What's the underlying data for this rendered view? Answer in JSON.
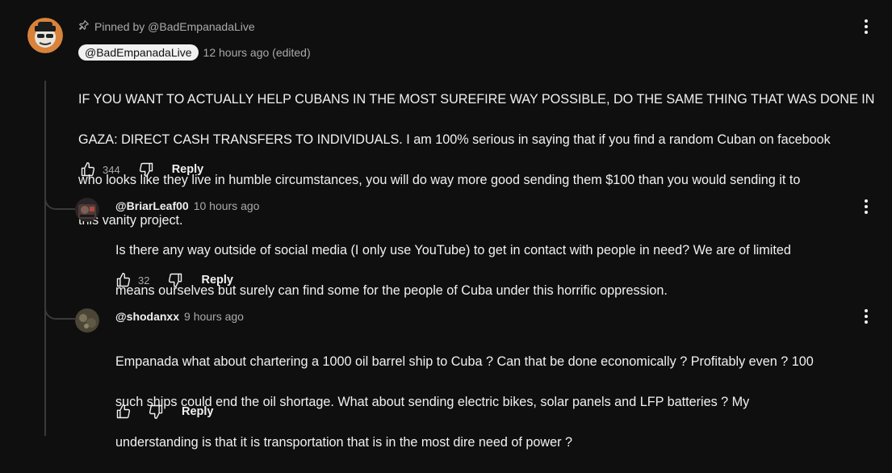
{
  "pinned": {
    "label": "Pinned by @BadEmpanadaLive"
  },
  "comments": [
    {
      "author": "@BadEmpanadaLive",
      "time": "12 hours ago (edited)",
      "lines": [
        "IF YOU WANT TO ACTUALLY HELP CUBANS IN THE MOST SUREFIRE WAY POSSIBLE, DO THE SAME THING THAT WAS DONE IN",
        "GAZA: DIRECT CASH TRANSFERS TO INDIVIDUALS. I am 100% serious in saying that if you find a random Cuban on facebook",
        "who looks like they live in humble circumstances, you will do way more good sending them $100 than you would sending it to",
        "this vanity project."
      ],
      "likes": "344",
      "reply": "Reply"
    },
    {
      "author": "@BriarLeaf00",
      "time": "10 hours ago",
      "lines": [
        "Is there any way outside of social media (I only use YouTube) to get in contact with people in need? We are of limited",
        "means ourselves but surely can find some for the people of Cuba under this horrific oppression."
      ],
      "likes": "32",
      "reply": "Reply"
    },
    {
      "author": "@shodanxx",
      "time": "9 hours ago",
      "lines": [
        "Empanada what about chartering a 1000 oil barrel ship to Cuba ? Can that be done economically ? Profitably even ?  100",
        "such ships could end the oil shortage. What about sending electric bikes, solar panels and LFP batteries ? My",
        "understanding is that it is transportation that is in the most dire need of power ?"
      ],
      "likes": "",
      "reply": "Reply"
    }
  ]
}
